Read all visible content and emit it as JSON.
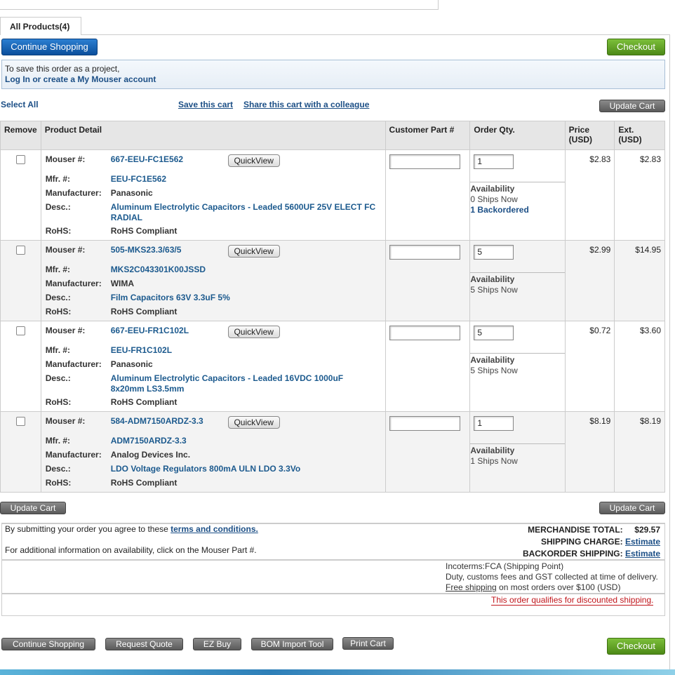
{
  "tab": {
    "label": "All Products(4)"
  },
  "buttons": {
    "continue_shopping": "Continue Shopping",
    "checkout": "Checkout",
    "update_cart": "Update Cart",
    "request_quote": "Request Quote",
    "ez_buy": "EZ Buy",
    "bom_import": "BOM Import Tool",
    "print_cart": "Print Cart"
  },
  "info": {
    "line1": "To save this order as a project,",
    "link": "Log In or create a My Mouser account"
  },
  "links": {
    "select_all": "Select All",
    "save_cart": "Save this cart",
    "share_cart": "Share this cart with a colleague"
  },
  "columns": {
    "remove": "Remove",
    "product_detail": "Product Detail",
    "customer_part": "Customer Part #",
    "order_qty": "Order Qty.",
    "price": "Price",
    "price_unit": "(USD)",
    "ext": "Ext.",
    "ext_unit": "(USD)"
  },
  "labels": {
    "mouser": "Mouser #:",
    "mfr": "Mfr. #:",
    "manufacturer": "Manufacturer:",
    "desc": "Desc.:",
    "rohs": "RoHS:",
    "quickview": "QuickView",
    "availability": "Availability"
  },
  "products": [
    {
      "mouser": "667-EEU-FC1E562",
      "mfr": "EEU-FC1E562",
      "manufacturer": "Panasonic",
      "desc": "Aluminum Electrolytic Capacitors - Leaded 5600UF 25V ELECT FC RADIAL",
      "rohs": "RoHS Compliant",
      "qty": "1",
      "ships": "0 Ships Now",
      "backorder": "1 Backordered",
      "price": "$2.83",
      "ext": "$2.83"
    },
    {
      "mouser": "505-MKS23.3/63/5",
      "mfr": "MKS2C043301K00JSSD",
      "manufacturer": "WIMA",
      "desc": "Film Capacitors 63V 3.3uF 5%",
      "rohs": "RoHS Compliant",
      "qty": "5",
      "ships": "5 Ships Now",
      "price": "$2.99",
      "ext": "$14.95"
    },
    {
      "mouser": "667-EEU-FR1C102L",
      "mfr": "EEU-FR1C102L",
      "manufacturer": "Panasonic",
      "desc": "Aluminum Electrolytic Capacitors - Leaded 16VDC 1000uF 8x20mm LS3.5mm",
      "rohs": "RoHS Compliant",
      "qty": "5",
      "ships": "5 Ships Now",
      "price": "$0.72",
      "ext": "$3.60"
    },
    {
      "mouser": "584-ADM7150ARDZ-3.3",
      "mfr": "ADM7150ARDZ-3.3",
      "manufacturer": "Analog Devices Inc.",
      "desc": "LDO Voltage Regulators 800mA ULN LDO 3.3Vo",
      "rohs": "RoHS Compliant",
      "qty": "1",
      "ships": "1 Ships Now",
      "price": "$8.19",
      "ext": "$8.19"
    }
  ],
  "terms": {
    "prefix": "By submitting your order you agree to these",
    "link": "terms and conditions.",
    "additional": "For additional information on availability, click on the Mouser Part #."
  },
  "totals": {
    "merch_label": "MERCHANDISE TOTAL:",
    "merch_value": "$29.57",
    "shipping_label": "SHIPPING CHARGE:",
    "backorder_label": "BACKORDER SHIPPING:",
    "estimate": "Estimate"
  },
  "incoterms": {
    "line1": "Incoterms:FCA (Shipping Point)",
    "line2": "Duty, customs fees and GST collected at time of delivery.",
    "free_link": "Free shipping",
    "line3_rest": " on most orders over $100 (USD)"
  },
  "discount": {
    "text": "This order qualifies for discounted shipping."
  }
}
